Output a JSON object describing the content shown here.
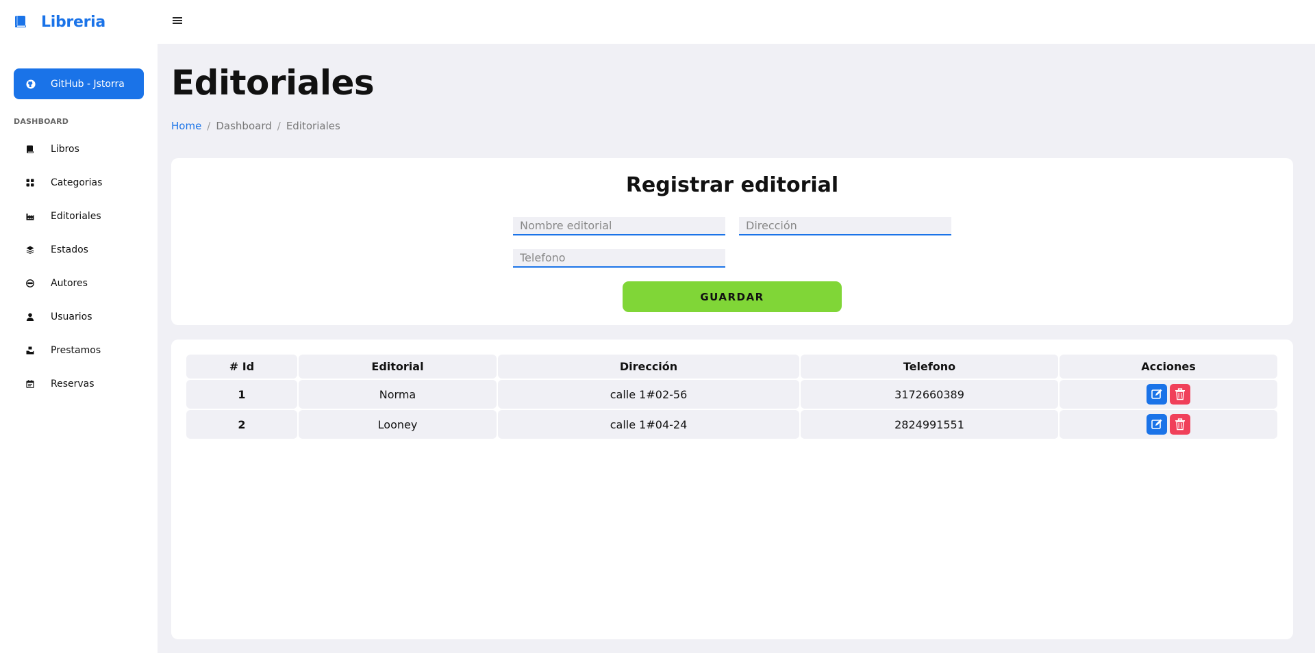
{
  "app": {
    "brand": "Libreria",
    "brand_color": "#1a73e8"
  },
  "sidebar": {
    "github_label": "GitHub - Jstorra",
    "heading": "DASHBOARD",
    "items": [
      {
        "label": "Libros",
        "icon": "book-icon"
      },
      {
        "label": "Categorias",
        "icon": "grid-icon"
      },
      {
        "label": "Editoriales",
        "icon": "factory-icon"
      },
      {
        "label": "Estados",
        "icon": "layers-icon"
      },
      {
        "label": "Autores",
        "icon": "mask-icon"
      },
      {
        "label": "Usuarios",
        "icon": "user-icon"
      },
      {
        "label": "Prestamos",
        "icon": "hand-box-icon"
      },
      {
        "label": "Reservas",
        "icon": "calendar-icon"
      }
    ]
  },
  "page": {
    "title": "Editoriales",
    "breadcrumb": [
      "Home",
      "Dashboard",
      "Editoriales"
    ]
  },
  "form": {
    "title": "Registrar editorial",
    "nombre_placeholder": "Nombre editorial",
    "direccion_placeholder": "Dirección",
    "telefono_placeholder": "Telefono",
    "save_label": "GUARDAR",
    "save_color": "#80d637"
  },
  "table": {
    "headers": [
      "# Id",
      "Editorial",
      "Dirección",
      "Telefono",
      "Acciones"
    ],
    "rows": [
      {
        "id": "1",
        "editorial": "Norma",
        "direccion": "calle 1#02-56",
        "telefono": "3172660389"
      },
      {
        "id": "2",
        "editorial": "Looney",
        "direccion": "calle 1#04-24",
        "telefono": "2824991551"
      }
    ],
    "edit_color": "#1a73e8",
    "delete_color": "#f0405a"
  }
}
